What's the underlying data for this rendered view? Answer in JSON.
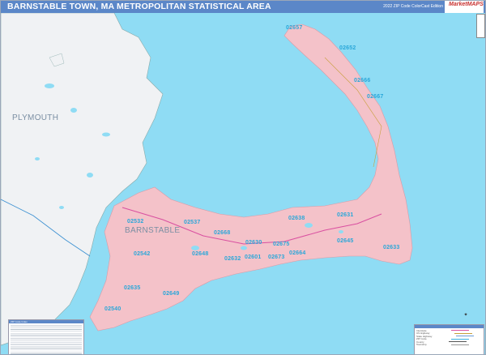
{
  "header": {
    "title": "BARNSTABLE TOWN, MA METROPOLITAN STATISTICAL AREA",
    "edition": "2022 ZIP Code ColorCast Edition",
    "logo": "MarketMAPS",
    "color": "#5b87c8"
  },
  "map": {
    "water_color": "#8fdcf4",
    "land_color": "#f4c2c9",
    "mainland_color": "#f0f2f4",
    "county_labels": [
      "PLYMOUTH",
      "BARNSTABLE"
    ],
    "zip_labels": [
      "02657",
      "02652",
      "02666",
      "02667",
      "02532",
      "02537",
      "02638",
      "02631",
      "02668",
      "02630",
      "02675",
      "02645",
      "02633",
      "02542",
      "02648",
      "02632",
      "02601",
      "02673",
      "02664",
      "02635",
      "02649",
      "02540"
    ]
  },
  "legend": {
    "rows": [
      "Interstate",
      "US Highway",
      "State Highway",
      "ZIP Code",
      "County",
      "Township"
    ],
    "line_colors": [
      "#d94fa0",
      "#c8a03c",
      "#6a9bd6",
      "#3ab0e0",
      "#555555",
      "#999999"
    ]
  },
  "index": {
    "title": "ZIP Code Index"
  },
  "icons": {
    "compass": "compass-icon",
    "scale": "scale-bar-icon"
  }
}
